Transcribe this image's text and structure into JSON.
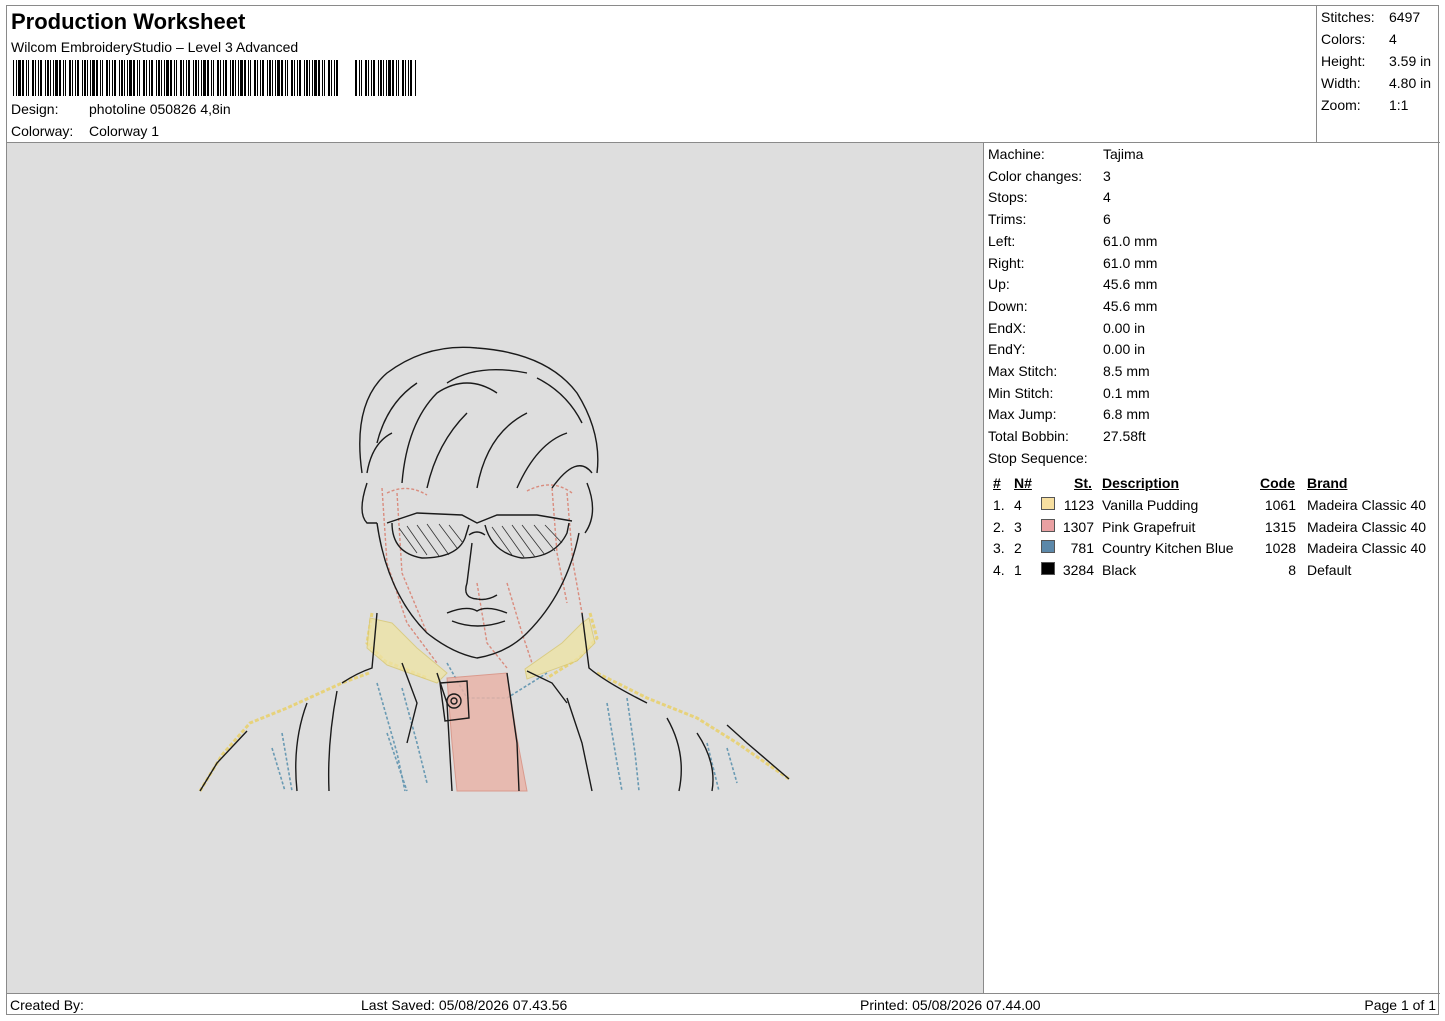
{
  "header": {
    "title": "Production Worksheet",
    "subtitle": "Wilcom EmbroideryStudio – Level 3 Advanced",
    "design_label": "Design:",
    "design_value": "photoline 050826 4,8in",
    "colorway_label": "Colorway:",
    "colorway_value": "Colorway 1"
  },
  "summary": {
    "stitches_label": "Stitches:",
    "stitches_value": "6497",
    "colors_label": "Colors:",
    "colors_value": "4",
    "height_label": "Height:",
    "height_value": "3.59 in",
    "width_label": "Width:",
    "width_value": "4.80 in",
    "zoom_label": "Zoom:",
    "zoom_value": "1:1"
  },
  "machine_info": [
    {
      "label": "Machine:",
      "value": "Tajima"
    },
    {
      "label": "Color changes:",
      "value": "3"
    },
    {
      "label": "Stops:",
      "value": "4"
    },
    {
      "label": "Trims:",
      "value": "6"
    },
    {
      "label": "Left:",
      "value": "61.0 mm"
    },
    {
      "label": "Right:",
      "value": "61.0 mm"
    },
    {
      "label": "Up:",
      "value": "45.6 mm"
    },
    {
      "label": "Down:",
      "value": "45.6 mm"
    },
    {
      "label": "EndX:",
      "value": "0.00 in"
    },
    {
      "label": "EndY:",
      "value": "0.00 in"
    },
    {
      "label": "Max Stitch:",
      "value": "8.5 mm"
    },
    {
      "label": "Min Stitch:",
      "value": "0.1 mm"
    },
    {
      "label": "Max Jump:",
      "value": "6.8 mm"
    },
    {
      "label": "Total Bobbin:",
      "value": "27.58ft"
    },
    {
      "label": "Stop Sequence:",
      "value": ""
    }
  ],
  "stop_sequence": {
    "headers": {
      "num": "#",
      "needle": "N#",
      "stitches": "St.",
      "description": "Description",
      "code": "Code",
      "brand": "Brand"
    },
    "rows": [
      {
        "num": "1.",
        "needle": "4",
        "color": "#f7dfa0",
        "stitches": "1123",
        "description": "Vanilla Pudding",
        "code": "1061",
        "brand": "Madeira Classic 40"
      },
      {
        "num": "2.",
        "needle": "3",
        "color": "#e9a0a2",
        "stitches": "1307",
        "description": "Pink Grapefruit",
        "code": "1315",
        "brand": "Madeira Classic 40"
      },
      {
        "num": "3.",
        "needle": "2",
        "color": "#5c88a9",
        "stitches": "781",
        "description": "Country Kitchen Blue",
        "code": "1028",
        "brand": "Madeira Classic 40"
      },
      {
        "num": "4.",
        "needle": "1",
        "color": "#000000",
        "stitches": "3284",
        "description": "Black",
        "code": "8",
        "brand": "Default"
      }
    ]
  },
  "footer": {
    "created_by": "Created By:",
    "last_saved": "Last Saved: 05/08/2026 07.43.56",
    "printed": "Printed: 05/08/2026 07.44.00",
    "page": "Page 1 of 1"
  }
}
